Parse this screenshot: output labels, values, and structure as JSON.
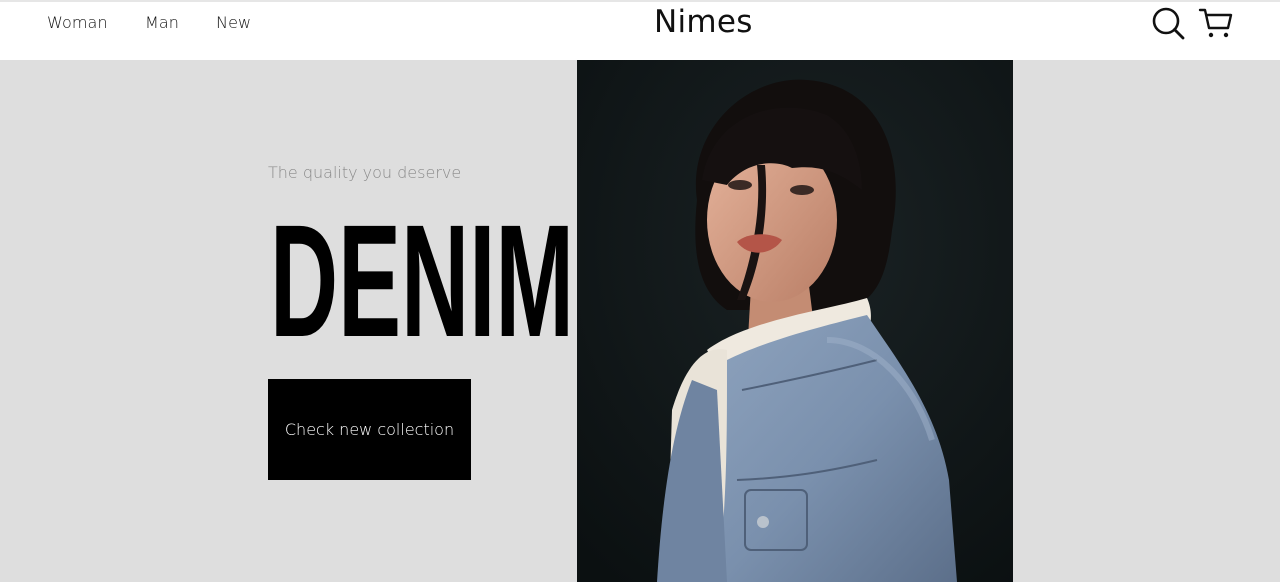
{
  "nav": {
    "items": [
      {
        "label": "Woman"
      },
      {
        "label": "Man"
      },
      {
        "label": "New"
      }
    ]
  },
  "brand": {
    "name": "Nimes"
  },
  "icons": {
    "search": "search-icon",
    "cart": "cart-icon"
  },
  "hero": {
    "tagline": "The quality you deserve",
    "headline": "DENIM",
    "cta_label": "Check new collection",
    "image": "woman-in-denim-jacket-photo"
  },
  "colors": {
    "background": "#dedede",
    "header_bg": "#ffffff",
    "text": "#111111",
    "tagline": "#8a8a8a",
    "cta_bg": "#000000",
    "cta_text": "#ffffff",
    "photo_bg": "#0f1516",
    "denim_blue": "#7f95b3"
  }
}
